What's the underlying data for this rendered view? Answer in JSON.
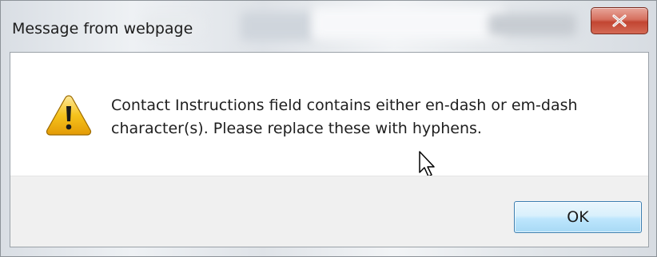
{
  "dialog": {
    "title": "Message from webpage",
    "close_icon": "close-x-icon",
    "icon": "warning-icon",
    "message": "Contact Instructions field contains either en-dash or em-dash\ncharacter(s).  Please replace these with hyphens.",
    "ok_label": "OK"
  },
  "colors": {
    "close_button": "#c24532",
    "ok_button_border": "#3c7fb1",
    "button_bar": "#f0f0f0",
    "warning_yellow": "#f6c21c"
  }
}
